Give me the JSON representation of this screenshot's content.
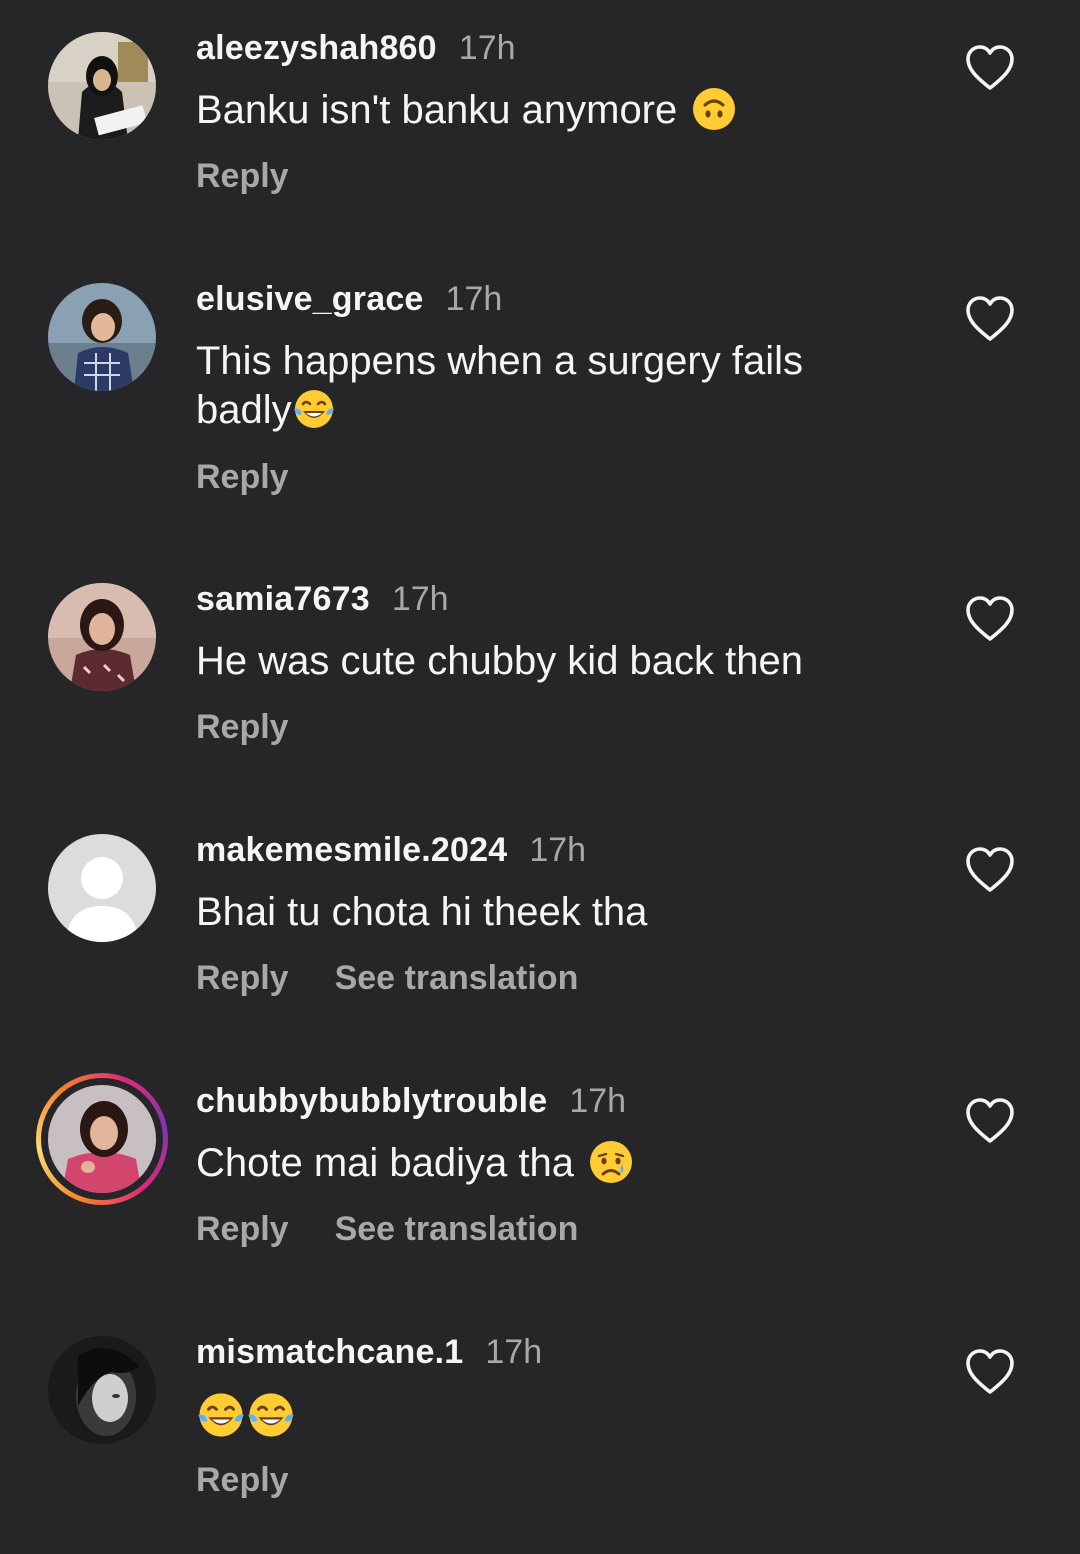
{
  "comments": [
    {
      "username": "aleezyshah860",
      "time": "17h",
      "text": "Banku isn't banku anymore",
      "emoji": "upside-down-face",
      "reply_label": "Reply",
      "avatar": "photo"
    },
    {
      "username": "elusive_grace",
      "time": "17h",
      "text": "This happens when a surgery fails badly",
      "emoji": "tears-of-joy",
      "reply_label": "Reply",
      "avatar": "photo"
    },
    {
      "username": "samia7673",
      "time": "17h",
      "text": "He was cute chubby kid back then",
      "reply_label": "Reply",
      "avatar": "photo"
    },
    {
      "username": "makemesmile.2024",
      "time": "17h",
      "text": "Bhai tu chota hi theek tha",
      "reply_label": "Reply",
      "translation_label": "See translation",
      "avatar": "default"
    },
    {
      "username": "chubbybubblytrouble",
      "time": "17h",
      "text": "Chote mai badiya tha",
      "emoji": "crying-face",
      "reply_label": "Reply",
      "translation_label": "See translation",
      "avatar": "photo-with-story-ring"
    },
    {
      "username": "mismatchcane.1",
      "time": "17h",
      "text": "",
      "emoji": "tears-of-joy x2",
      "reply_label": "Reply",
      "avatar": "photo"
    }
  ],
  "icons": {
    "like": "heart-outline-icon"
  },
  "colors": {
    "background": "#262628",
    "primary_text": "#f5f5f5",
    "secondary_text": "#a8a8a8"
  }
}
